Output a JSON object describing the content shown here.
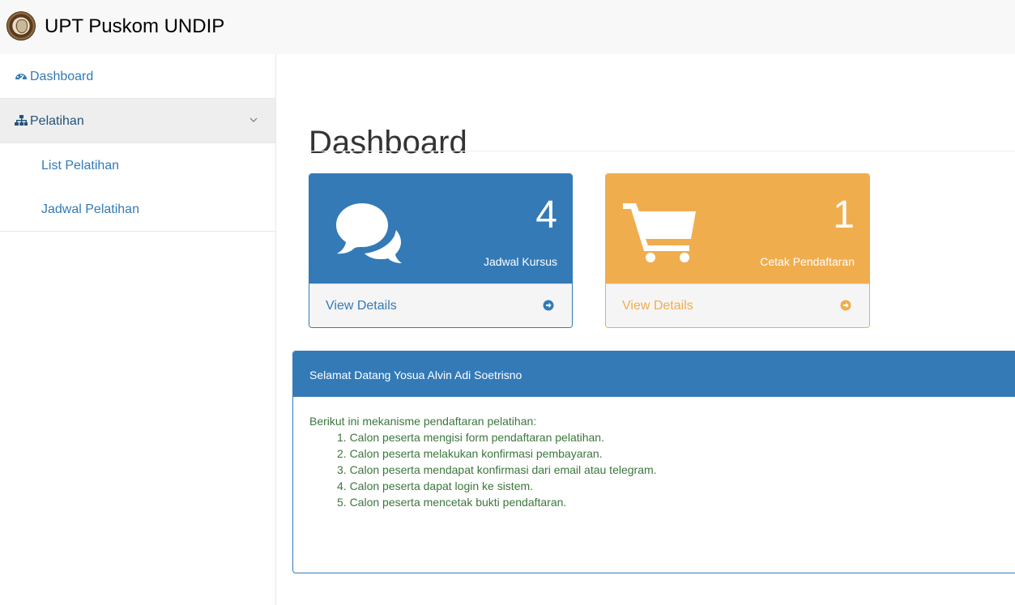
{
  "brand": {
    "title": "UPT Puskom UNDIP"
  },
  "sidebar": {
    "dashboard_label": "Dashboard",
    "pelatihan_label": "Pelatihan",
    "sub_items": [
      "List Pelatihan",
      "Jadwal Pelatihan"
    ]
  },
  "page": {
    "title": "Dashboard"
  },
  "cards": [
    {
      "count": "4",
      "label": "Jadwal Kursus",
      "link": "View Details",
      "color": "#337ab7",
      "icon": "comments-icon"
    },
    {
      "count": "1",
      "label": "Cetak Pendaftaran",
      "link": "View Details",
      "color": "#f0ad4e",
      "icon": "shopping-cart-icon"
    }
  ],
  "welcome": {
    "title": "Selamat Datang Yosua Alvin Adi Soetrisno",
    "intro": "Berikut ini mekanisme pendaftaran pelatihan:",
    "steps": [
      "1. Calon peserta mengisi form pendaftaran pelatihan.",
      "2. Calon peserta melakukan konfirmasi pembayaran.",
      "3. Calon peserta mendapat konfirmasi dari email atau telegram.",
      "4. Calon peserta dapat login ke sistem.",
      "5. Calon peserta mencetak bukti pendaftaran."
    ],
    "text_color": "#3c763d"
  }
}
